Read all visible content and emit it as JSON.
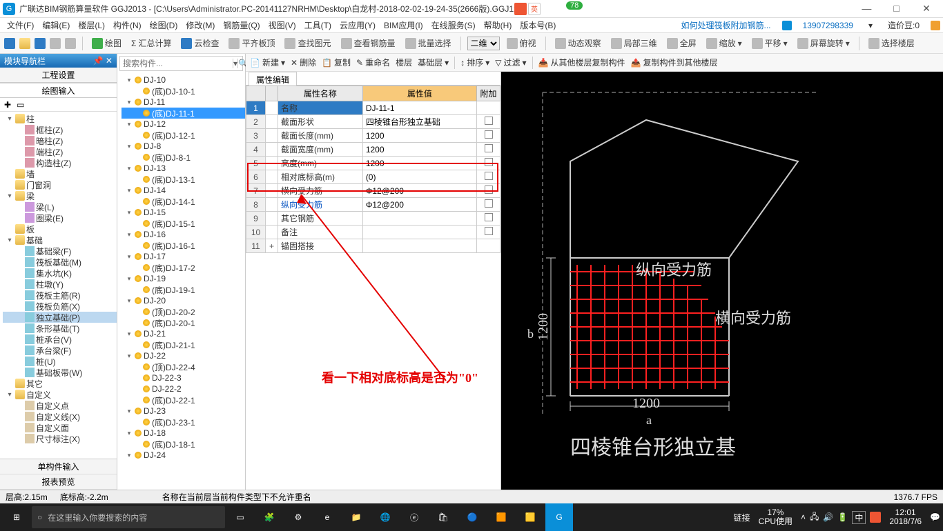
{
  "titlebar": {
    "app": "广联达BIM钢筋算量软件 GGJ2013 - [C:\\Users\\Administrator.PC-20141127NRHM\\Desktop\\白龙村-2018-02-02-19-24-35(2666版).GGJ12]",
    "badge": "78"
  },
  "menu": {
    "items": [
      "文件(F)",
      "编辑(E)",
      "楼层(L)",
      "构件(N)",
      "绘图(D)",
      "修改(M)",
      "钢筋量(Q)",
      "视图(V)",
      "工具(T)",
      "云应用(Y)",
      "BIM应用(I)",
      "在线服务(S)",
      "帮助(H)",
      "版本号(B)"
    ],
    "link": "如何处理筏板附加钢筋...",
    "user": "13907298339",
    "bean": "造价豆:0"
  },
  "toolbar1": {
    "items": [
      "绘图",
      "汇总计算",
      "云检查",
      "平齐板顶",
      "查找图元",
      "查看钢筋量",
      "批量选择"
    ],
    "view": "二维",
    "items2": [
      "俯视",
      "动态观察",
      "局部三维",
      "全屏",
      "缩放",
      "平移",
      "屏幕旋转",
      "选择楼层"
    ]
  },
  "nav": {
    "header": "模块导航栏",
    "tabs": [
      "工程设置",
      "绘图输入"
    ],
    "groups": [
      {
        "label": "柱",
        "children": [
          "框柱(Z)",
          "暗柱(Z)",
          "端柱(Z)",
          "构造柱(Z)"
        ]
      },
      {
        "label": "墙",
        "children": []
      },
      {
        "label": "门窗洞",
        "children": []
      },
      {
        "label": "梁",
        "children": [
          "梁(L)",
          "圈梁(E)"
        ]
      },
      {
        "label": "板",
        "children": []
      },
      {
        "label": "基础",
        "children": [
          "基础梁(F)",
          "筏板基础(M)",
          "集水坑(K)",
          "柱墩(Y)",
          "筏板主筋(R)",
          "筏板负筋(X)",
          "独立基础(P)",
          "条形基础(T)",
          "桩承台(V)",
          "承台梁(F)",
          "桩(U)",
          "基础板带(W)"
        ]
      },
      {
        "label": "其它",
        "children": []
      },
      {
        "label": "自定义",
        "children": [
          "自定义点",
          "自定义线(X)",
          "自定义面",
          "尺寸标注(X)"
        ]
      }
    ],
    "selected": "独立基础(P)",
    "bottom": [
      "单构件输入",
      "报表预览"
    ]
  },
  "mid": {
    "toolbar": [
      "新建",
      "删除",
      "复制",
      "重命名",
      "楼层",
      "基础层"
    ],
    "search_ph": "搜索构件...",
    "tree": [
      {
        "l": "DJ-10",
        "c": [
          "(底)DJ-10-1"
        ]
      },
      {
        "l": "DJ-11",
        "c": [
          "(底)DJ-11-1"
        ]
      },
      {
        "l": "DJ-12",
        "c": [
          "(底)DJ-12-1"
        ]
      },
      {
        "l": "DJ-8",
        "c": [
          "(底)DJ-8-1"
        ]
      },
      {
        "l": "DJ-13",
        "c": [
          "(底)DJ-13-1"
        ]
      },
      {
        "l": "DJ-14",
        "c": [
          "(底)DJ-14-1"
        ]
      },
      {
        "l": "DJ-15",
        "c": [
          "(底)DJ-15-1"
        ]
      },
      {
        "l": "DJ-16",
        "c": [
          "(底)DJ-16-1"
        ]
      },
      {
        "l": "DJ-17",
        "c": [
          "(底)DJ-17-2"
        ]
      },
      {
        "l": "DJ-19",
        "c": [
          "(底)DJ-19-1"
        ]
      },
      {
        "l": "DJ-20",
        "c": [
          "(顶)DJ-20-2",
          "(底)DJ-20-1"
        ]
      },
      {
        "l": "DJ-21",
        "c": [
          "(底)DJ-21-1"
        ]
      },
      {
        "l": "DJ-22",
        "c": [
          "(顶)DJ-22-4",
          "DJ-22-3",
          "DJ-22-2",
          "(底)DJ-22-1"
        ]
      },
      {
        "l": "DJ-23",
        "c": [
          "(底)DJ-23-1"
        ]
      },
      {
        "l": "DJ-18",
        "c": [
          "(底)DJ-18-1"
        ]
      },
      {
        "l": "DJ-24",
        "c": []
      }
    ],
    "selected": "(底)DJ-11-1"
  },
  "ribbon": {
    "items": [
      "排序",
      "过滤",
      "从其他楼层复制构件",
      "复制构件到其他楼层"
    ]
  },
  "prop": {
    "tab": "属性编辑",
    "headers": [
      "属性名称",
      "属性值",
      "附加"
    ],
    "rows": [
      {
        "n": "1",
        "name": "名称",
        "val": "DJ-11-1",
        "chk": false,
        "sel": true
      },
      {
        "n": "2",
        "name": "截面形状",
        "val": "四棱锥台形独立基础",
        "chk": true
      },
      {
        "n": "3",
        "name": "截面长度(mm)",
        "val": "1200",
        "chk": true
      },
      {
        "n": "4",
        "name": "截面宽度(mm)",
        "val": "1200",
        "chk": true
      },
      {
        "n": "5",
        "name": "高度(mm)",
        "val": "1200",
        "chk": true
      },
      {
        "n": "6",
        "name": "相对底标高(m)",
        "val": "(0)",
        "chk": true
      },
      {
        "n": "7",
        "name": "横向受力筋",
        "val": "Φ12@200",
        "chk": true
      },
      {
        "n": "8",
        "name": "纵向受力筋",
        "val": "Φ12@200",
        "chk": true
      },
      {
        "n": "9",
        "name": "其它钢筋",
        "val": "",
        "chk": true
      },
      {
        "n": "10",
        "name": "备注",
        "val": "",
        "chk": true
      },
      {
        "n": "11",
        "name": "锚固搭接",
        "val": "",
        "plus": true
      }
    ]
  },
  "annotation": "看一下相对底标高是否为\"0\"",
  "viewport": {
    "label1": "纵向受力筋",
    "label2": "横向受力筋",
    "dim_b": "1200",
    "dim_a": "1200",
    "axis_b": "b",
    "axis_a": "a",
    "title": "四棱锥台形独立基"
  },
  "status": {
    "left1": "层高:2.15m",
    "left2": "底标高:-2.2m",
    "mid": "名称在当前层当前构件类型下不允许重名",
    "right": "1376.7 FPS"
  },
  "taskbar": {
    "search_ph": "在这里输入你要搜索的内容",
    "net": "链接",
    "cpu1": "17%",
    "cpu2": "CPU使用",
    "ime": "中",
    "time": "12:01",
    "date": "2018/7/6"
  }
}
